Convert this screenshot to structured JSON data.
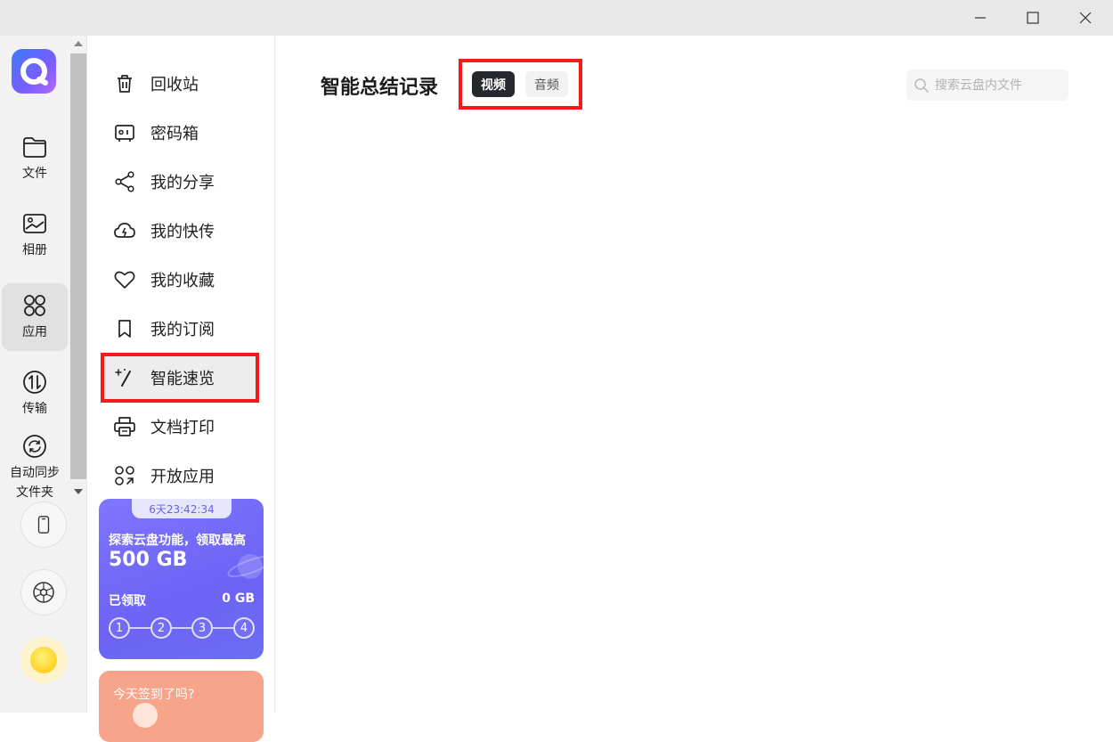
{
  "rail": {
    "items": [
      {
        "label": "文件"
      },
      {
        "label": "相册"
      },
      {
        "label": "应用"
      },
      {
        "label": "传输"
      },
      {
        "label": "自动同步文件夹"
      }
    ]
  },
  "sidebar": {
    "items": [
      {
        "label": "回收站"
      },
      {
        "label": "密码箱"
      },
      {
        "label": "我的分享"
      },
      {
        "label": "我的快传"
      },
      {
        "label": "我的收藏"
      },
      {
        "label": "我的订阅"
      },
      {
        "label": "智能速览"
      },
      {
        "label": "文档打印"
      },
      {
        "label": "开放应用"
      }
    ]
  },
  "promo": {
    "timer": "6天23:42:34",
    "text": "探索云盘功能，领取最高",
    "amount": "500 GB",
    "claimed_label": "已领取",
    "claimed_value": "0 GB",
    "steps": [
      "1",
      "2",
      "3",
      "4"
    ]
  },
  "checkin": {
    "text": "今天签到了吗?"
  },
  "main": {
    "title": "智能总结记录",
    "tabs": [
      {
        "label": "视频",
        "active": true
      },
      {
        "label": "音频",
        "active": false
      }
    ],
    "search_placeholder": "搜索云盘内文件"
  },
  "colors": {
    "highlight": "#f41a1a",
    "active_tab": "#25282d",
    "promo": "#7f75ff",
    "checkin": "#f7a48b"
  }
}
